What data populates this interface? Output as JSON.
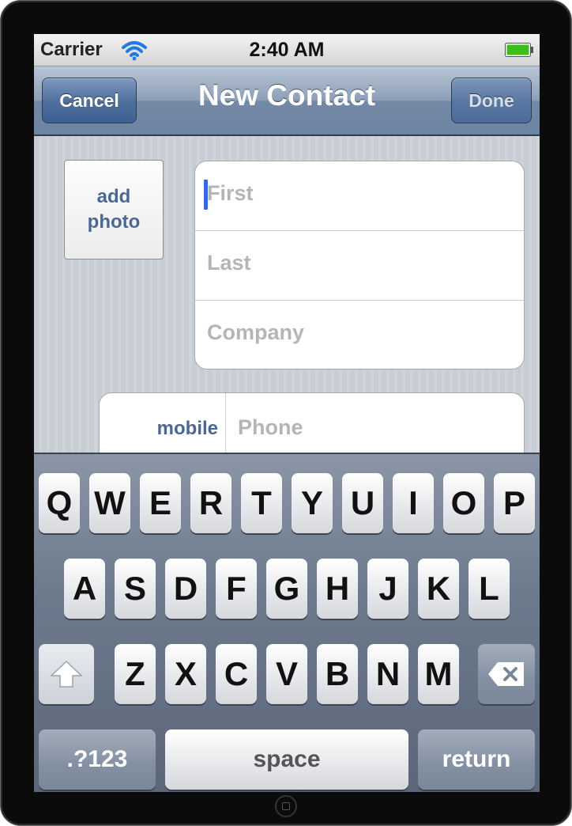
{
  "status": {
    "carrier": "Carrier",
    "time": "2:40 AM"
  },
  "nav": {
    "title": "New Contact",
    "cancel": "Cancel",
    "done": "Done"
  },
  "photo": {
    "line1": "add",
    "line2": "photo"
  },
  "fields": {
    "first": "First",
    "last": "Last",
    "company": "Company"
  },
  "phone": {
    "label": "mobile",
    "placeholder": "Phone"
  },
  "keyboard": {
    "row1": [
      "Q",
      "W",
      "E",
      "R",
      "T",
      "Y",
      "U",
      "I",
      "O",
      "P"
    ],
    "row2": [
      "A",
      "S",
      "D",
      "F",
      "G",
      "H",
      "J",
      "K",
      "L"
    ],
    "row3": [
      "Z",
      "X",
      "C",
      "V",
      "B",
      "N",
      "M"
    ],
    "numbers": ".?123",
    "space": "space",
    "return": "return"
  },
  "colors": {
    "accent": "#4c6795",
    "cursor": "#3a66e6",
    "battery": "#3dbf17"
  }
}
